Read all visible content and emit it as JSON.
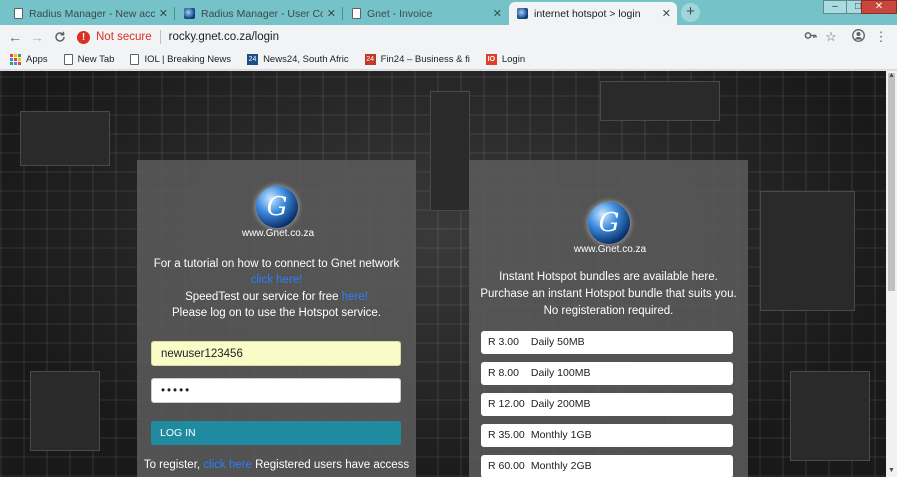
{
  "browser": {
    "tabs": [
      {
        "title": "Radius Manager - New accoun",
        "icon": "document-icon",
        "active": false
      },
      {
        "title": "Radius Manager - User Control P",
        "icon": "gnet-favicon",
        "active": false
      },
      {
        "title": "Gnet - Invoice",
        "icon": "document-icon",
        "active": false
      },
      {
        "title": "internet hotspot > login",
        "icon": "gnet-favicon",
        "active": true
      }
    ],
    "new_tab_glyph": "+",
    "window_controls": {
      "minimize": "–",
      "maximize": "□",
      "close": "✕"
    },
    "toolbar": {
      "back": "←",
      "forward": "→",
      "reload": "C",
      "security_label": "Not secure",
      "url": "rocky.gnet.co.za/login"
    },
    "bookmarks": [
      {
        "label": "Apps",
        "icon": "apps-grid-icon"
      },
      {
        "label": "New Tab",
        "icon": "document-icon"
      },
      {
        "label": "IOL | Breaking News",
        "icon": "document-icon"
      },
      {
        "label": "News24, South Afric",
        "icon": "news24-icon"
      },
      {
        "label": "Fin24 – Business & fi",
        "icon": "fin24-icon"
      },
      {
        "label": "Login",
        "icon": "login-icon"
      }
    ],
    "bookmark_badges": {
      "news24": "24",
      "fin24": "24",
      "login": "IO"
    }
  },
  "login_panel": {
    "logo_letter": "G",
    "logo_text": "www.Gnet.co.za",
    "tutorial_text": "For a tutorial on how to connect to Gnet network",
    "tutorial_link": "click here!",
    "speedtest_text": "SpeedTest our service for free",
    "speedtest_link": "here!",
    "instruction": "Please log on to use the Hotspot service.",
    "username_value": "newuser123456",
    "password_value": "•••••",
    "login_button": "LOG IN",
    "register_prefix": "To register,",
    "register_link": "click here",
    "register_suffix": "Registered users have access"
  },
  "bundles_panel": {
    "logo_letter": "G",
    "logo_text": "www.Gnet.co.za",
    "line1": "Instant Hotspot bundles are available here.",
    "line2": "Purchase an instant Hotspot bundle that suits you.",
    "line3": "No registeration required.",
    "bundles": [
      {
        "price": "R 3.00",
        "name": "Daily 50MB"
      },
      {
        "price": "R 8.00",
        "name": "Daily 100MB"
      },
      {
        "price": "R 12.00",
        "name": "Daily 200MB"
      },
      {
        "price": "R 35.00",
        "name": "Monthly 1GB"
      },
      {
        "price": "R 60.00",
        "name": "Monthly 2GB"
      }
    ]
  }
}
